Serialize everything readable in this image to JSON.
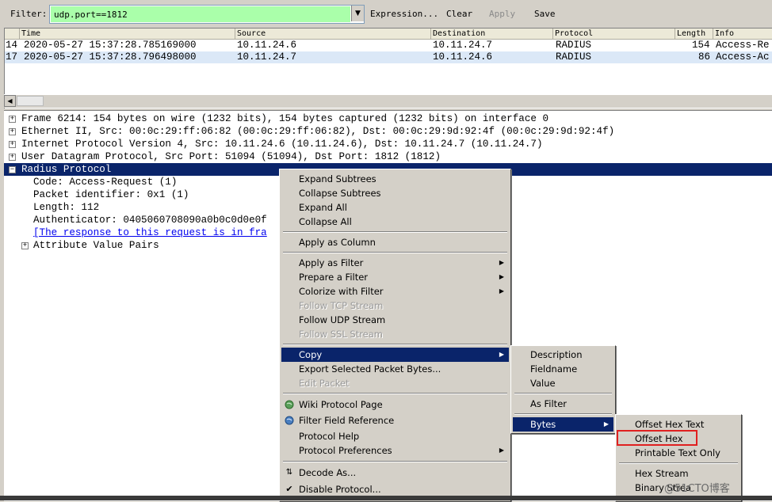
{
  "toolbar": {
    "filter_label": "Filter:",
    "filter_value": "udp.port==1812",
    "expression_label": "Expression...",
    "clear_label": "Clear",
    "apply_label": "Apply",
    "save_label": "Save"
  },
  "packet_list": {
    "columns": [
      "Time",
      "Source",
      "Destination",
      "Protocol",
      "Length",
      "Info"
    ],
    "rows": [
      {
        "no": "14",
        "time": "2020-05-27 15:37:28.785169000",
        "source": "10.11.24.6",
        "destination": "10.11.24.7",
        "protocol": "RADIUS",
        "length": "154",
        "info": "Access-Re"
      },
      {
        "no": "17",
        "time": "2020-05-27 15:37:28.796498000",
        "source": "10.11.24.7",
        "destination": "10.11.24.6",
        "protocol": "RADIUS",
        "length": "86",
        "info": "Access-Ac"
      }
    ]
  },
  "details": {
    "rows": [
      {
        "text": "Frame 6214: 154 bytes on wire (1232 bits), 154 bytes captured (1232 bits) on interface 0"
      },
      {
        "text": "Ethernet II, Src: 00:0c:29:ff:06:82 (00:0c:29:ff:06:82), Dst: 00:0c:29:9d:92:4f (00:0c:29:9d:92:4f)"
      },
      {
        "text": "Internet Protocol Version 4, Src: 10.11.24.6 (10.11.24.6), Dst: 10.11.24.7 (10.11.24.7)"
      },
      {
        "text": "User Datagram Protocol, Src Port: 51094 (51094), Dst Port: 1812 (1812)"
      },
      {
        "text": "Radius Protocol"
      },
      {
        "text": "Code: Access-Request (1)"
      },
      {
        "text": "Packet identifier: 0x1 (1)"
      },
      {
        "text": "Length: 112"
      },
      {
        "text": "Authenticator: 0405060708090a0b0c0d0e0f"
      },
      {
        "text": "[The response to this request is in fra"
      },
      {
        "text": "Attribute Value Pairs"
      }
    ]
  },
  "context_menu": {
    "expand_subtrees": "Expand Subtrees",
    "collapse_subtrees": "Collapse Subtrees",
    "expand_all": "Expand All",
    "collapse_all": "Collapse All",
    "apply_as_column": "Apply as Column",
    "apply_as_filter": "Apply as Filter",
    "prepare_a_filter": "Prepare a Filter",
    "colorize_with_filter": "Colorize with Filter",
    "follow_tcp_stream": "Follow TCP Stream",
    "follow_udp_stream": "Follow UDP Stream",
    "follow_ssl_stream": "Follow SSL Stream",
    "copy": "Copy",
    "export_selected_packet_bytes": "Export Selected Packet Bytes...",
    "edit_packet": "Edit Packet",
    "wiki_protocol_page": "Wiki Protocol Page",
    "filter_field_reference": "Filter Field Reference",
    "protocol_help": "Protocol Help",
    "protocol_preferences": "Protocol Preferences",
    "decode_as": "Decode As...",
    "disable_protocol": "Disable Protocol..."
  },
  "copy_submenu": {
    "description": "Description",
    "fieldname": "Fieldname",
    "value": "Value",
    "as_filter": "As Filter",
    "bytes": "Bytes"
  },
  "bytes_submenu": {
    "offset_hex_text": "Offset Hex Text",
    "offset_hex": "Offset Hex",
    "printable_text_only": "Printable Text Only",
    "hex_stream": "Hex Stream",
    "binary_stream": "Binary Strea"
  },
  "watermark": "@51CTO博客",
  "colors": {
    "filter_valid_bg": "#aaffaa",
    "selection_bg": "#0a246a",
    "highlight_box": "#e02020",
    "second_row_bg": "#dbe8f7"
  }
}
